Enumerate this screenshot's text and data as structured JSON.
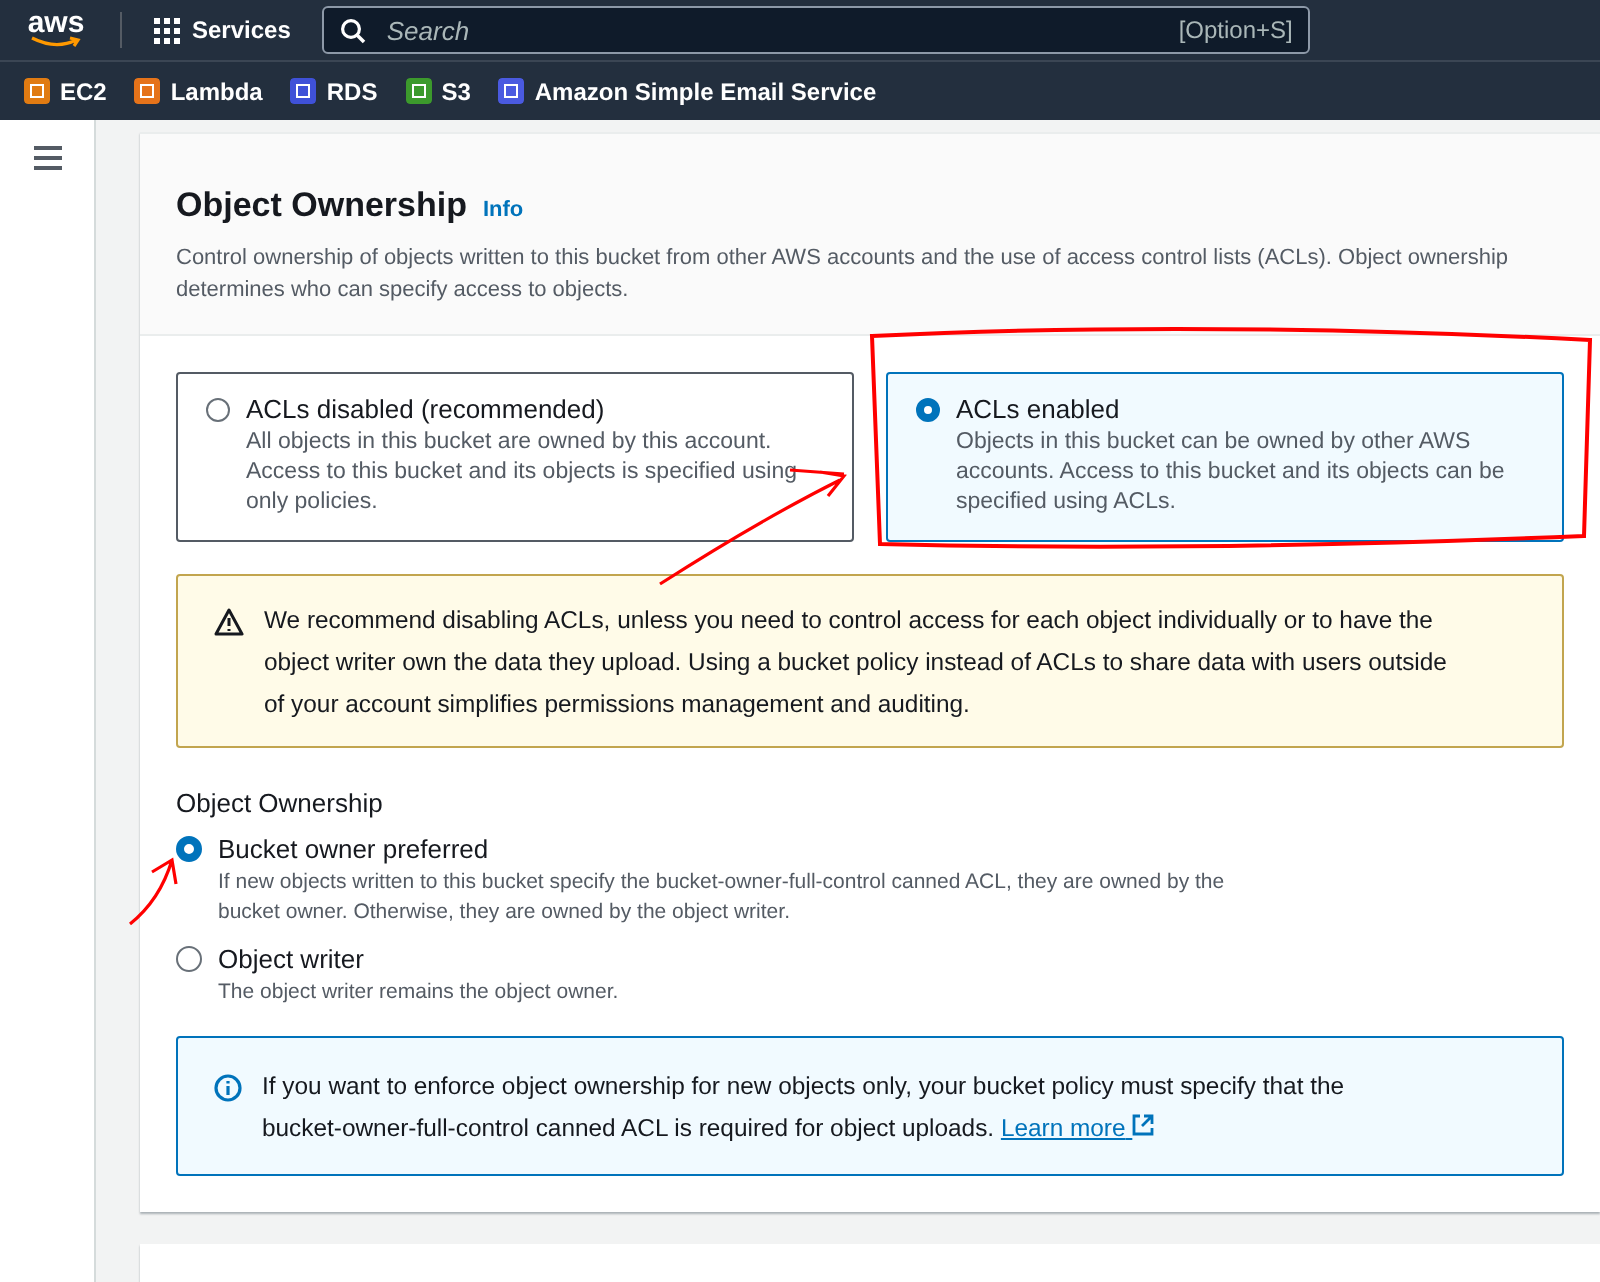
{
  "top_nav": {
    "logo": "aws",
    "services": "Services",
    "search": {
      "placeholder": "Search"
    },
    "shortcut": "[Option+S]"
  },
  "favorites": [
    {
      "label": "EC2",
      "color": "#e07b12"
    },
    {
      "label": "Lambda",
      "color": "#e5731a"
    },
    {
      "label": "RDS",
      "color": "#3f51d8"
    },
    {
      "label": "S3",
      "color": "#3c9a2c"
    },
    {
      "label": "Amazon Simple Email Service",
      "color": "#4a5ae0"
    }
  ],
  "panel": {
    "title": "Object Ownership",
    "info": "Info",
    "description": "Control ownership of objects written to this bucket from other AWS accounts and the use of access control lists (ACLs). Object ownership determines who can specify access to objects.",
    "tiles": [
      {
        "label": "ACLs disabled (recommended)",
        "description": "All objects in this bucket are owned by this account. Access to this bucket and its objects is specified using only policies.",
        "selected": false
      },
      {
        "label": "ACLs enabled",
        "description": "Objects in this bucket can be owned by other AWS accounts. Access to this bucket and its objects can be specified using ACLs.",
        "selected": true
      }
    ],
    "warning": "We recommend disabling ACLs, unless you need to control access for each object individually or to have the object writer own the data they upload. Using a bucket policy instead of ACLs to share data with users outside of your account simplifies permissions management and auditing.",
    "ownership": {
      "label": "Object Ownership",
      "options": [
        {
          "label": "Bucket owner preferred",
          "description": "If new objects written to this bucket specify the bucket-owner-full-control canned ACL, they are owned by the bucket owner. Otherwise, they are owned by the object writer.",
          "selected": true
        },
        {
          "label": "Object writer",
          "description": "The object writer remains the object owner.",
          "selected": false
        }
      ]
    },
    "info_alert": {
      "text": "If you want to enforce object ownership for new objects only, your bucket policy must specify that the bucket-owner-full-control canned ACL is required for object uploads.",
      "link": "Learn more"
    }
  }
}
